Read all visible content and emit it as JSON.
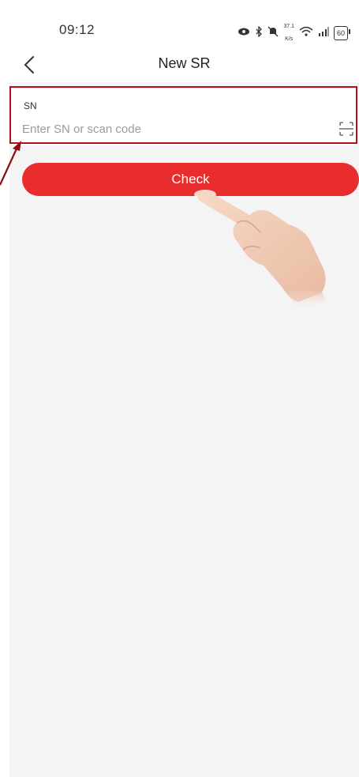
{
  "status_bar": {
    "time": "09:12",
    "network_speed_value": "37.1",
    "network_speed_unit": "K/s",
    "battery": "60"
  },
  "nav": {
    "title": "New SR",
    "back_icon": "chevron-left-icon"
  },
  "sn_field": {
    "label": "SN",
    "value": "",
    "placeholder": "Enter SN or scan code",
    "scan_icon": "scan-icon"
  },
  "check_button": {
    "label": "Check"
  },
  "colors": {
    "accent": "#e92d2f",
    "highlight_border": "#b3101c",
    "background": "#f4f4f4"
  }
}
